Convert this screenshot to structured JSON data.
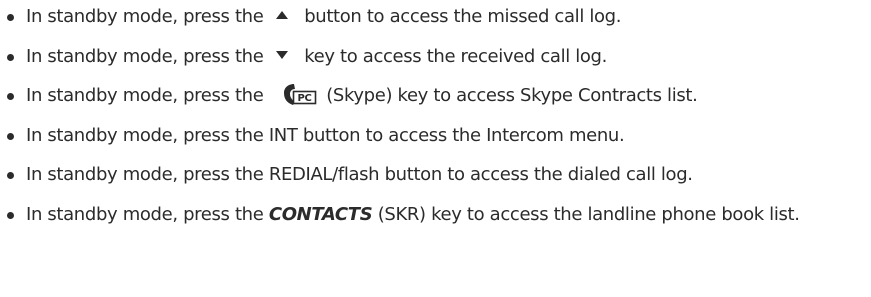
{
  "items": [
    {
      "pre": "In standby mode, press the",
      "icon": "up-arrow-icon",
      "post": "button to access the missed call log."
    },
    {
      "pre": "In standby mode, press the",
      "icon": "down-arrow-icon",
      "post": "key to access the received call log."
    },
    {
      "pre": "In standby mode, press the",
      "icon": "skype-pc-key-icon",
      "post": "(Skype)  key to access Skype Contracts list."
    },
    {
      "text": "In standby mode, press the INT button to access the Intercom menu."
    },
    {
      "text": "In standby mode, press the REDIAL/flash button to access the dialed call log."
    },
    {
      "pre": "In standby mode, press the",
      "emphasis": "CONTACTS",
      "post": "(SKR) key to access the landline phone book list."
    }
  ]
}
